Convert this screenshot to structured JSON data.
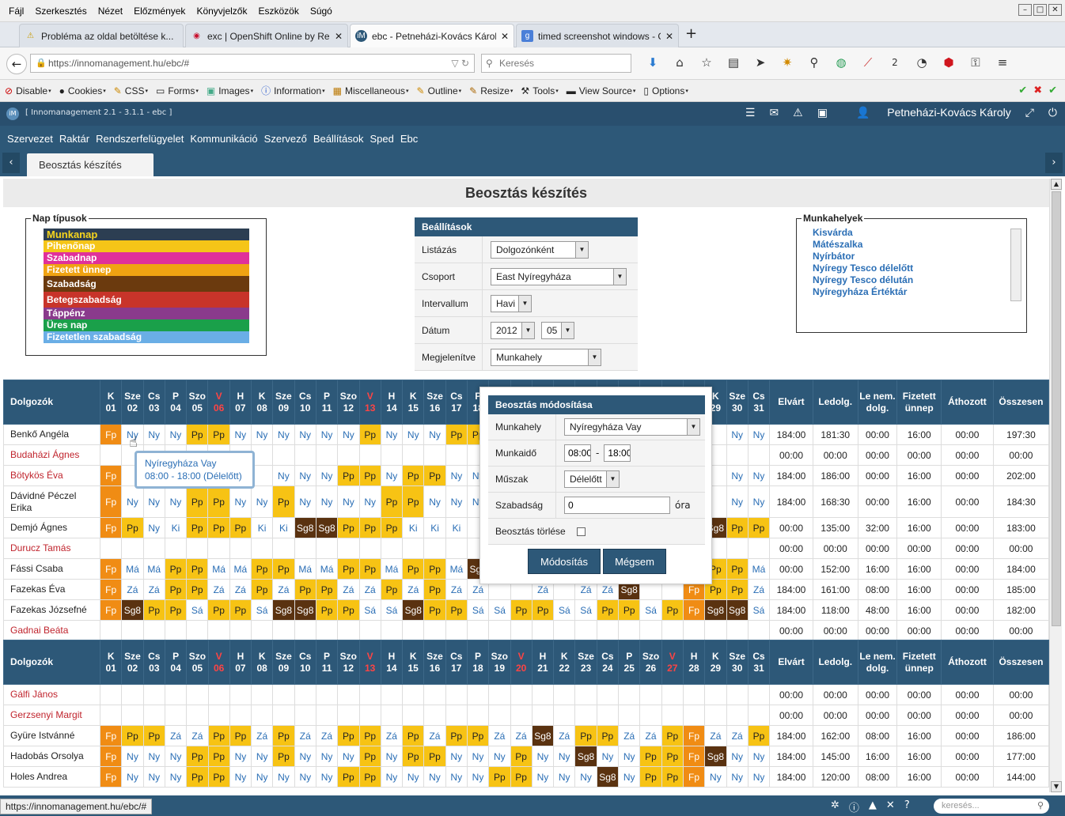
{
  "menubar": {
    "items": [
      "Fájl",
      "Szerkesztés",
      "Nézet",
      "Előzmények",
      "Könyvjelzők",
      "Eszközök",
      "Súgó"
    ]
  },
  "tabs": [
    {
      "label": "Probléma az oldal betöltése k...",
      "icon": "warning-icon"
    },
    {
      "label": "exc | OpenShift Online by Re...",
      "icon": "openshift-icon"
    },
    {
      "label": "ebc - Petneházi-Kovács Károl...",
      "icon": "app-icon",
      "active": true
    },
    {
      "label": "timed screenshot windows - G...",
      "icon": "google-icon"
    }
  ],
  "url": "https://innomanagement.hu/ebc/#",
  "search_placeholder": "Keresés",
  "toolbar_badge": "2",
  "devbar": [
    "Disable",
    "Cookies",
    "CSS",
    "Forms",
    "Images",
    "Information",
    "Miscellaneous",
    "Outline",
    "Resize",
    "Tools",
    "View Source",
    "Options"
  ],
  "app": {
    "version": "[ Innomanagement 2.1 - 3.1.1 - ebc ]",
    "user": "Petneházi-Kovács Károly",
    "logo": "iM"
  },
  "appnav": [
    "Szervezet",
    "Raktár",
    "Rendszerfelügyelet",
    "Kommunikáció",
    "Szervező",
    "Beállítások",
    "Sped",
    "Ebc"
  ],
  "page_tab": "Beosztás készítés",
  "page_title": "Beosztás készítés",
  "nap_tipusok": {
    "legend": "Nap típusok",
    "items": [
      {
        "label": "Munkanap",
        "color": "#2c3e52",
        "text": "#f7d51d"
      },
      {
        "label": "Pihenőnap",
        "color": "#f5c518",
        "text": "#ffffff"
      },
      {
        "label": "Szabadnap",
        "color": "#e0309a",
        "text": "#ffffff"
      },
      {
        "label": "Fizetett ünnep",
        "color": "#f0a312",
        "text": "#ffffff"
      },
      {
        "label": "Szabadság",
        "color": "#6b3a0e",
        "text": "#ffffff"
      },
      {
        "label": "Betegszabadság",
        "color": "#c8342a",
        "text": "#ffffff"
      },
      {
        "label": "Táppénz",
        "color": "#8a3a8c",
        "text": "#ffffff"
      },
      {
        "label": "Üres nap",
        "color": "#1aa04a",
        "text": "#ffffff"
      },
      {
        "label": "Fizetetlen szabadság",
        "color": "#6aaee6",
        "text": "#ffffff"
      }
    ]
  },
  "beallitasok": {
    "title": "Beállítások",
    "rows": [
      {
        "label": "Listázás",
        "value": "Dolgozónként"
      },
      {
        "label": "Csoport",
        "value": "East Nyíregyháza"
      },
      {
        "label": "Intervallum",
        "value": "Havi"
      },
      {
        "label": "Dátum",
        "value": "2012",
        "value2": "05"
      },
      {
        "label": "Megjelenítve",
        "value": "Munkahely"
      }
    ]
  },
  "munkahelyek": {
    "legend": "Munkahelyek",
    "items": [
      "Kisvárda",
      "Mátészalka",
      "Nyírbátor",
      "Nyíregy Tesco délelőtt",
      "Nyíregy Tesco délután",
      "Nyíregyháza Értéktár"
    ]
  },
  "grid_header": {
    "first": "Dolgozók",
    "days": [
      [
        "K",
        "01"
      ],
      [
        "Sze",
        "02"
      ],
      [
        "Cs",
        "03"
      ],
      [
        "P",
        "04"
      ],
      [
        "Szo",
        "05"
      ],
      [
        "V",
        "06"
      ],
      [
        "H",
        "07"
      ],
      [
        "K",
        "08"
      ],
      [
        "Sze",
        "09"
      ],
      [
        "Cs",
        "10"
      ],
      [
        "P",
        "11"
      ],
      [
        "Szo",
        "12"
      ],
      [
        "V",
        "13"
      ],
      [
        "H",
        "14"
      ],
      [
        "K",
        "15"
      ],
      [
        "Sze",
        "16"
      ],
      [
        "Cs",
        "17"
      ],
      [
        "P",
        "18"
      ],
      [
        "Szo",
        "19"
      ],
      [
        "V",
        "20"
      ],
      [
        "H",
        "21"
      ],
      [
        "K",
        "22"
      ],
      [
        "Sze",
        "23"
      ],
      [
        "Cs",
        "24"
      ],
      [
        "P",
        "25"
      ],
      [
        "Szo",
        "26"
      ],
      [
        "V",
        "27"
      ],
      [
        "H",
        "28"
      ],
      [
        "K",
        "29"
      ],
      [
        "Sze",
        "30"
      ],
      [
        "Cs",
        "31"
      ]
    ],
    "totals": [
      "Elvárt",
      "Ledolg.",
      "Le nem. dolg.",
      "Fizetett ünnep",
      "Áthozott",
      "Összesen"
    ]
  },
  "grid1": [
    {
      "name": "Benkő Angéla",
      "red": false,
      "cells": [
        "Fp",
        "Ny",
        "Ny",
        "Ny",
        "Pp",
        "Pp",
        "Ny",
        "Ny",
        "Ny",
        "Ny",
        "Ny",
        "Ny",
        "Pp",
        "Ny",
        "Ny",
        "Ny",
        "Pp",
        "Pp",
        "",
        "",
        "",
        "",
        "",
        "",
        "",
        "",
        "",
        "",
        "",
        "Ny",
        "Ny"
      ],
      "totals": [
        "184:00",
        "181:30",
        "00:00",
        "16:00",
        "00:00",
        "197:30"
      ]
    },
    {
      "name": "Budaházi Ágnes",
      "red": true,
      "cells": [],
      "totals": [
        "00:00",
        "00:00",
        "00:00",
        "00:00",
        "00:00",
        "00:00"
      ]
    },
    {
      "name": "Bötykös Éva",
      "red": true,
      "cells": [
        "Fp",
        "",
        "",
        "",
        "",
        "",
        "",
        "",
        "Ny",
        "Ny",
        "Ny",
        "Pp",
        "Pp",
        "Ny",
        "Pp",
        "Pp",
        "Ny",
        "Ny",
        "",
        "",
        "",
        "",
        "",
        "",
        "",
        "",
        "",
        "",
        "",
        "Ny",
        "Ny"
      ],
      "totals": [
        "184:00",
        "186:00",
        "00:00",
        "16:00",
        "00:00",
        "202:00"
      ]
    },
    {
      "name": "Dávidné Péczel Erika",
      "red": false,
      "tall": true,
      "cells": [
        "Fp",
        "Ny",
        "Ny",
        "Ny",
        "Pp",
        "Pp",
        "Ny",
        "Ny",
        "Pp",
        "Ny",
        "Ny",
        "Ny",
        "Ny",
        "Pp",
        "Pp",
        "Ny",
        "Ny",
        "Ny",
        "",
        "",
        "",
        "",
        "",
        "",
        "",
        "",
        "",
        "",
        "",
        "Ny",
        "Ny"
      ],
      "totals": [
        "184:00",
        "168:30",
        "00:00",
        "16:00",
        "00:00",
        "184:30"
      ]
    },
    {
      "name": "Demjó Ágnes",
      "red": false,
      "cells": [
        "Fp",
        "Pp",
        "Ny",
        "Ki",
        "Pp",
        "Pp",
        "Pp",
        "Ki",
        "Ki",
        "Sg8",
        "Sg8",
        "Pp",
        "Pp",
        "Pp",
        "Ki",
        "Ki",
        "Ki",
        "",
        "",
        "",
        "",
        "",
        "",
        "",
        "",
        "",
        "",
        "",
        "Sg8",
        "Pp",
        "Pp"
      ],
      "totals": [
        "00:00",
        "135:00",
        "32:00",
        "16:00",
        "00:00",
        "183:00"
      ]
    },
    {
      "name": "Durucz Tamás",
      "red": true,
      "cells": [],
      "totals": [
        "00:00",
        "00:00",
        "00:00",
        "00:00",
        "00:00",
        "00:00"
      ]
    },
    {
      "name": "Fássi Csaba",
      "red": false,
      "cells": [
        "Fp",
        "Má",
        "Má",
        "Pp",
        "Pp",
        "Má",
        "Má",
        "Pp",
        "Pp",
        "Má",
        "Má",
        "Pp",
        "Pp",
        "Má",
        "Pp",
        "Pp",
        "Má",
        "Sg8",
        "",
        "",
        "",
        "",
        "",
        "",
        "",
        "",
        "",
        "",
        "Pp",
        "Pp",
        "Má"
      ],
      "totals": [
        "00:00",
        "152:00",
        "16:00",
        "16:00",
        "00:00",
        "184:00"
      ]
    },
    {
      "name": "Fazekas Éva",
      "red": false,
      "cells": [
        "Fp",
        "Zá",
        "Zá",
        "Pp",
        "Pp",
        "Zá",
        "Zá",
        "Pp",
        "Zá",
        "Pp",
        "Pp",
        "Zá",
        "Zá",
        "Pp",
        "Zá",
        "Pp",
        "Zá",
        "Zá",
        "",
        "",
        "Zá",
        "",
        "Zá",
        "Zá",
        "Sg8",
        "",
        "",
        "Fp",
        "Pp",
        "Pp",
        "Zá"
      ],
      "totals": [
        "184:00",
        "161:00",
        "08:00",
        "16:00",
        "00:00",
        "185:00"
      ]
    },
    {
      "name": "Fazekas Józsefné",
      "red": false,
      "cells": [
        "Fp",
        "Sg8",
        "Pp",
        "Pp",
        "Sá",
        "Pp",
        "Pp",
        "Sá",
        "Sg8",
        "Sg8",
        "Pp",
        "Pp",
        "Sá",
        "Sá",
        "Sg8",
        "Pp",
        "Pp",
        "Sá",
        "Sá",
        "Pp",
        "Pp",
        "Sá",
        "Sá",
        "Pp",
        "Pp",
        "Sá",
        "Pp",
        "Fp",
        "Sg8",
        "Sg8",
        "Sá"
      ],
      "totals": [
        "184:00",
        "118:00",
        "48:00",
        "16:00",
        "00:00",
        "182:00"
      ]
    },
    {
      "name": "Gadnai Beáta",
      "red": true,
      "cells": [],
      "totals": [
        "00:00",
        "00:00",
        "00:00",
        "00:00",
        "00:00",
        "00:00"
      ]
    }
  ],
  "grid2": [
    {
      "name": "Gálfi János",
      "red": true,
      "cells": [],
      "totals": [
        "00:00",
        "00:00",
        "00:00",
        "00:00",
        "00:00",
        "00:00"
      ]
    },
    {
      "name": "Gerzsenyi Margit",
      "red": true,
      "cells": [],
      "totals": [
        "00:00",
        "00:00",
        "00:00",
        "00:00",
        "00:00",
        "00:00"
      ]
    },
    {
      "name": "Gyüre Istvánné",
      "red": false,
      "cells": [
        "Fp",
        "Pp",
        "Pp",
        "Zá",
        "Zá",
        "Pp",
        "Pp",
        "Zá",
        "Pp",
        "Zá",
        "Zá",
        "Pp",
        "Pp",
        "Zá",
        "Pp",
        "Zá",
        "Pp",
        "Pp",
        "Zá",
        "Zá",
        "Sg8",
        "Zá",
        "Pp",
        "Pp",
        "Zá",
        "Zá",
        "Pp",
        "Fp",
        "Zá",
        "Zá",
        "Pp"
      ],
      "totals": [
        "184:00",
        "162:00",
        "08:00",
        "16:00",
        "00:00",
        "186:00"
      ]
    },
    {
      "name": "Hadobás Orsolya",
      "red": false,
      "cells": [
        "Fp",
        "Ny",
        "Ny",
        "Ny",
        "Pp",
        "Pp",
        "Ny",
        "Ny",
        "Pp",
        "Ny",
        "Ny",
        "Ny",
        "Pp",
        "Ny",
        "Pp",
        "Pp",
        "Ny",
        "Ny",
        "Ny",
        "Pp",
        "Ny",
        "Ny",
        "Sg8",
        "Ny",
        "Ny",
        "Pp",
        "Pp",
        "Fp",
        "Sg8",
        "Ny",
        "Ny"
      ],
      "totals": [
        "184:00",
        "145:00",
        "16:00",
        "16:00",
        "00:00",
        "177:00"
      ]
    },
    {
      "name": "Holes Andrea",
      "red": false,
      "cells": [
        "Fp",
        "Ny",
        "Ny",
        "Ny",
        "Pp",
        "Pp",
        "Ny",
        "Ny",
        "Ny",
        "Ny",
        "Ny",
        "Pp",
        "Pp",
        "Ny",
        "Ny",
        "Ny",
        "Ny",
        "Ny",
        "Pp",
        "Pp",
        "Ny",
        "Ny",
        "Ny",
        "Sg8",
        "Ny",
        "Pp",
        "Pp",
        "Fp",
        "Ny",
        "Ny",
        "Ny"
      ],
      "totals": [
        "184:00",
        "120:00",
        "08:00",
        "16:00",
        "00:00",
        "144:00"
      ]
    }
  ],
  "tooltip": {
    "line1": "Nyíregyháza Vay",
    "line2": "08:00 - 18:00 (Délelőtt)"
  },
  "dialog": {
    "title": "Beosztás módosítása",
    "munkahely_label": "Munkahely",
    "munkahely_value": "Nyíregyháza Vay",
    "munkaido_label": "Munkaidő",
    "from": "08:00",
    "to": "18:00",
    "sep": "-",
    "muszak_label": "Műszak",
    "muszak_value": "Délelőtt",
    "szabadsag_label": "Szabadság",
    "szabadsag_value": "0",
    "ora": "óra",
    "torles_label": "Beosztás törlése",
    "ok": "Módosítás",
    "cancel": "Mégsem"
  },
  "status": {
    "url": "https://innomanagement.hu/ebc/#",
    "search_placeholder": "keresés..."
  }
}
